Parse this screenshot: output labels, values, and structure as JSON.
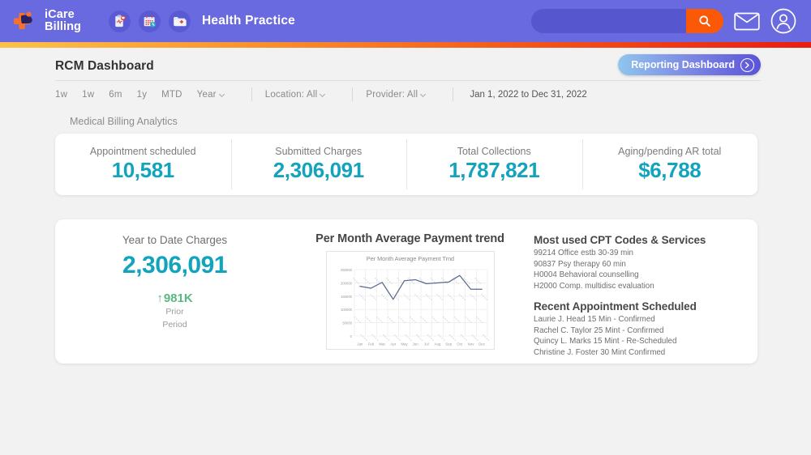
{
  "topnav": {
    "logo_line1": "iCare",
    "logo_line2": "Billing",
    "practice_name": "Health Practice",
    "icons": [
      "clipboard-vitals-icon",
      "calendar-clock-icon",
      "medical-folder-icon"
    ],
    "search_placeholder": "",
    "search_value": "",
    "brand_purple": "#6a6ae0",
    "accent_orange": "#fb5808"
  },
  "header": {
    "page_title": "RCM Dashboard",
    "reporting_button": "Reporting Dashboard"
  },
  "filters": {
    "segments": [
      "1w",
      "1w",
      "6m",
      "1y",
      "MTD"
    ],
    "year_dropdown": "Year",
    "location_dropdown": "Location: All",
    "provider_dropdown": "Provider: All",
    "date_range": "Jan 1, 2022 to Dec 31, 2022"
  },
  "analytics": {
    "section_label": "Medical Billing Analytics",
    "kpis": [
      {
        "label": "Appointment scheduled",
        "value": "10,581"
      },
      {
        "label": "Submitted Charges",
        "value": "2,306,091"
      },
      {
        "label": "Total Collections",
        "value": "1,787,821"
      },
      {
        "label": "Aging/pending AR total",
        "value": "$6,788"
      }
    ],
    "kpi_value_color": "#13a4bd"
  },
  "ytd": {
    "label": "Year to Date Charges",
    "value": "2,306,091",
    "delta_arrow": "↑",
    "delta_value": "981K",
    "delta_color": "#5cb780",
    "sub_line1": "Prior",
    "sub_line2": "Period"
  },
  "chart_panel": {
    "heading": "Per Month Average Payment trend"
  },
  "cpt": {
    "heading": "Most used CPT Codes & Services",
    "items": [
      "99214 Office estb 30-39 min",
      "90837 Psy therapy 60 min",
      "H0004 Behavioral counselling",
      "H2000 Comp. multidisc evaluation"
    ]
  },
  "appointments": {
    "heading": "Recent Appointment Scheduled",
    "items": [
      "Laurie J. Head 15 Min - Confirmed",
      "Rachel C. Taylor 25 Mint - Confirmed",
      "Quincy L. Marks 15 Mint - Re-Scheduled",
      "Christine J. Foster 30 Mint Confirmed"
    ]
  },
  "chart_data": {
    "type": "line",
    "title": "Per Month Average Payment Trnd",
    "xlabel": "",
    "ylabel": "",
    "categories": [
      "Jan",
      "Feb",
      "Mar",
      "Apr",
      "May",
      "Jun",
      "Jul",
      "Aug",
      "Sep",
      "Oct",
      "Nov",
      "Dec"
    ],
    "values": [
      187000,
      180000,
      202000,
      138000,
      208000,
      212000,
      197000,
      200000,
      203000,
      228000,
      176000,
      176000
    ],
    "yticks": [
      0,
      50000,
      100000,
      150000,
      200000,
      250000
    ],
    "ytick_labels": [
      "0",
      "50000",
      "100000",
      "150000",
      "200000",
      "250000"
    ],
    "ylim": [
      0,
      250000
    ],
    "grid": true,
    "legend": false,
    "series_color": "#5a6b8c"
  }
}
